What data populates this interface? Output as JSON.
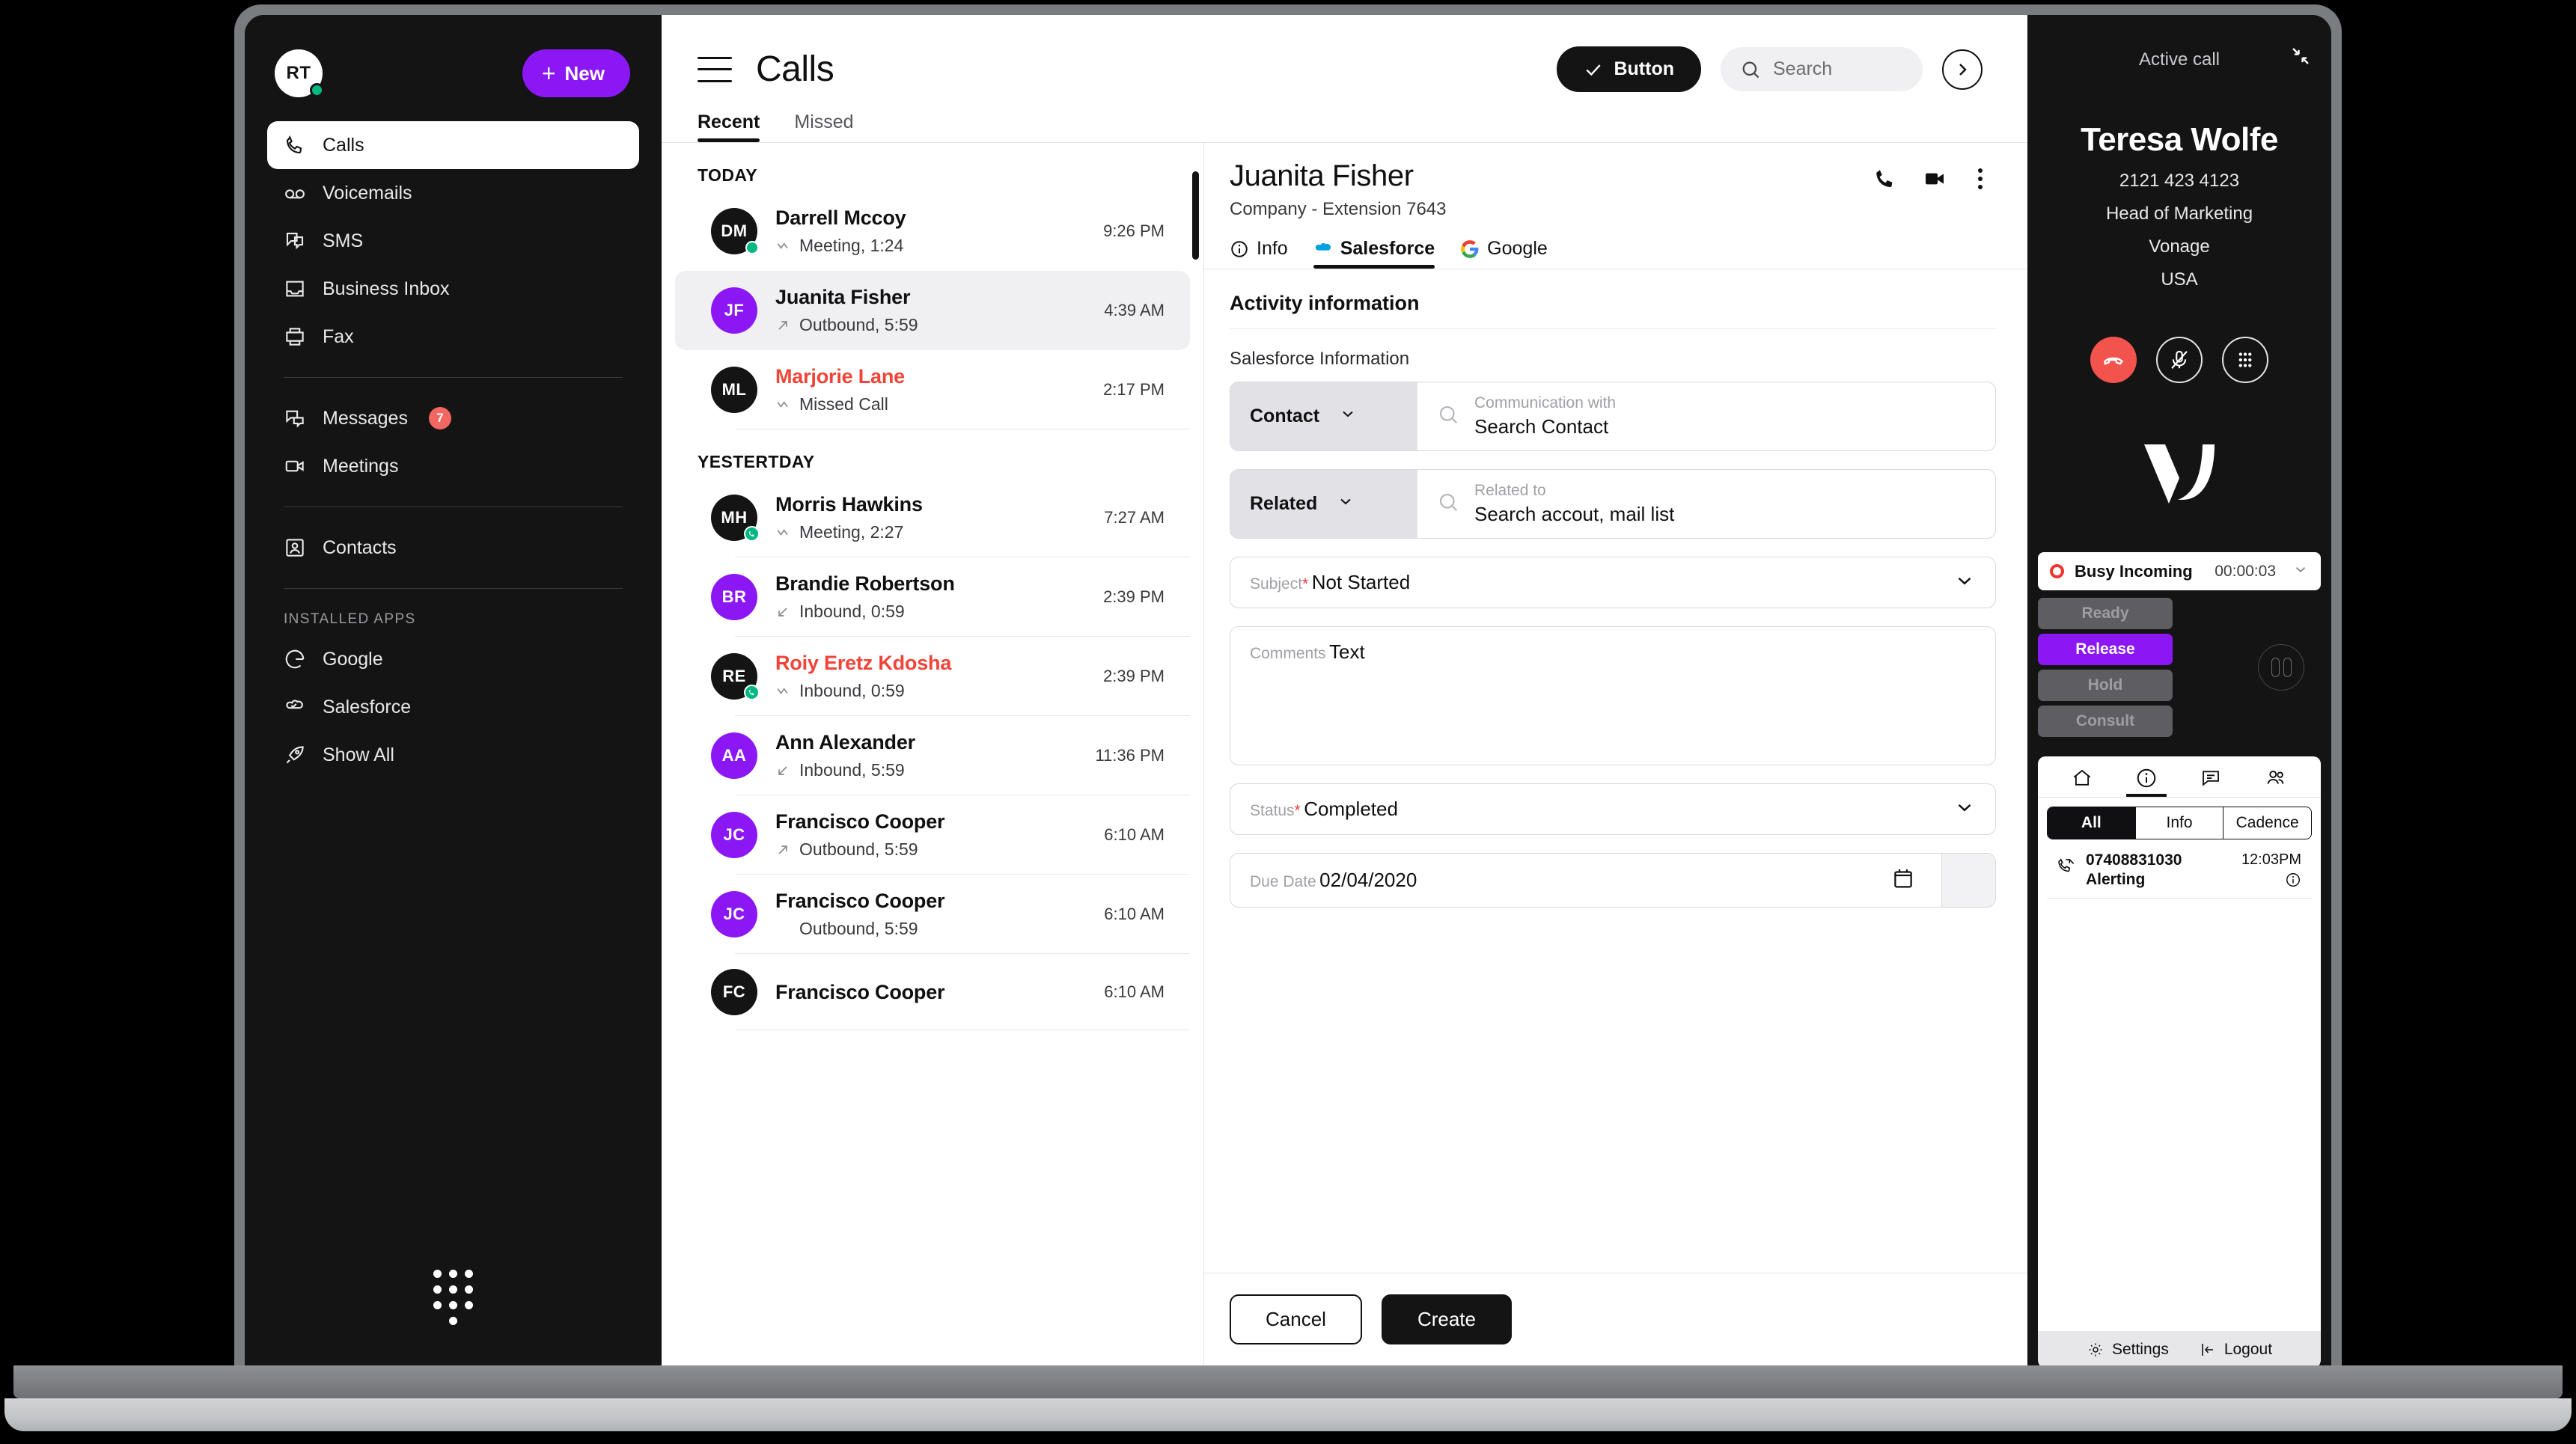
{
  "sidebar": {
    "avatar_initials": "RT",
    "new_button": "New",
    "items": [
      {
        "label": "Calls",
        "icon": "phone-icon"
      },
      {
        "label": "Voicemails",
        "icon": "voicemail-icon"
      },
      {
        "label": "SMS",
        "icon": "sms-icon"
      },
      {
        "label": "Business Inbox",
        "icon": "inbox-icon"
      },
      {
        "label": "Fax",
        "icon": "fax-icon"
      }
    ],
    "items2": [
      {
        "label": "Messages",
        "icon": "chat-icon",
        "badge": "7"
      },
      {
        "label": "Meetings",
        "icon": "video-icon"
      }
    ],
    "items3": [
      {
        "label": "Contacts",
        "icon": "contacts-icon"
      }
    ],
    "apps_label": "Installed apps",
    "apps": [
      {
        "label": "Google",
        "icon": "google-icon"
      },
      {
        "label": "Salesforce",
        "icon": "salesforce-cloud-icon"
      },
      {
        "label": "Show All",
        "icon": "rocket-icon"
      }
    ]
  },
  "header": {
    "title": "Calls",
    "button_label": "Button",
    "search_placeholder": "Search",
    "tabs": [
      {
        "label": "Recent",
        "active": true
      },
      {
        "label": "Missed",
        "active": false
      }
    ]
  },
  "call_list": {
    "groups": [
      {
        "label": "TODAY",
        "calls": [
          {
            "initials": "DM",
            "name": "Darrell Mccoy",
            "time": "9:26 PM",
            "detail": "Meeting, 1:24",
            "direction": "missed-arrow",
            "avatar": "dark",
            "presence": "online",
            "missed": false,
            "selected": false
          },
          {
            "initials": "JF",
            "name": "Juanita Fisher",
            "time": "4:39 AM",
            "detail": "Outbound, 5:59",
            "direction": "outbound",
            "avatar": "purple",
            "presence": "none",
            "missed": false,
            "selected": true
          },
          {
            "initials": "ML",
            "name": "Marjorie Lane",
            "time": "2:17 PM",
            "detail": "Missed Call",
            "direction": "missed-arrow",
            "avatar": "dark",
            "presence": "none",
            "missed": true,
            "selected": false
          }
        ]
      },
      {
        "label": "YESTERTDAY",
        "calls": [
          {
            "initials": "MH",
            "name": "Morris Hawkins",
            "time": "7:27 AM",
            "detail": "Meeting, 2:27",
            "direction": "missed-arrow",
            "avatar": "dark",
            "presence": "call",
            "missed": false,
            "selected": false
          },
          {
            "initials": "BR",
            "name": "Brandie Robertson",
            "time": "2:39 PM",
            "detail": "Inbound, 0:59",
            "direction": "inbound",
            "avatar": "purple",
            "presence": "none",
            "missed": false,
            "selected": false
          },
          {
            "initials": "RE",
            "name": "Roiy Eretz Kdosha",
            "time": "2:39 PM",
            "detail": "Inbound, 0:59",
            "direction": "missed-arrow",
            "avatar": "dark",
            "presence": "call",
            "missed": true,
            "selected": false
          },
          {
            "initials": "AA",
            "name": "Ann Alexander",
            "time": "11:36 PM",
            "detail": "Inbound, 5:59",
            "direction": "inbound",
            "avatar": "purple",
            "presence": "none",
            "missed": false,
            "selected": false
          },
          {
            "initials": "JC",
            "name": "Francisco Cooper",
            "time": "6:10 AM",
            "detail": "Outbound, 5:59",
            "direction": "outbound",
            "avatar": "purple",
            "presence": "none",
            "missed": false,
            "selected": false
          },
          {
            "initials": "JC",
            "name": "Francisco Cooper",
            "time": "6:10 AM",
            "detail": "Outbound, 5:59",
            "direction": "none",
            "avatar": "purple",
            "presence": "none",
            "missed": false,
            "selected": false
          },
          {
            "initials": "FC",
            "name": "Francisco Cooper",
            "time": "6:10 AM",
            "detail": "",
            "direction": "none",
            "avatar": "dark",
            "presence": "none",
            "missed": false,
            "selected": false
          }
        ]
      }
    ]
  },
  "detail": {
    "contact_name": "Juanita Fisher",
    "contact_meta": "Company -  Extension 7643",
    "tabs": [
      {
        "label": "Info",
        "icon": "info-icon",
        "active": false
      },
      {
        "label": "Salesforce",
        "icon": "salesforce-icon",
        "active": true
      },
      {
        "label": "Google",
        "icon": "google-icon",
        "active": false
      }
    ],
    "section_title": "Activity information",
    "subsection_title": "Salesforce Information",
    "fields": {
      "contact": {
        "picker_value": "Contact",
        "label": "Communication with",
        "value": "Search Contact"
      },
      "related": {
        "picker_value": "Related",
        "label": "Related to",
        "value": "Search accout, mail list"
      },
      "subject": {
        "label": "Subject",
        "required": "*",
        "value": "Not Started"
      },
      "comments": {
        "label": "Comments",
        "value": "Text"
      },
      "status": {
        "label": "Status",
        "required": "*",
        "value": "Completed"
      },
      "due_date": {
        "label": "Due Date",
        "value": "02/04/2020"
      }
    },
    "cancel_label": "Cancel",
    "create_label": "Create"
  },
  "cti": {
    "header_label": "Active call",
    "contact_name": "Teresa Wolfe",
    "phone": "2121 423 4123",
    "title": "Head of Marketing",
    "company": "Vonage",
    "country": "USA",
    "status": {
      "label": "Busy Incoming",
      "timer": "00:00:03"
    },
    "state_buttons": [
      {
        "label": "Ready",
        "active": false
      },
      {
        "label": "Release",
        "active": true
      },
      {
        "label": "Hold",
        "active": false
      },
      {
        "label": "Consult",
        "active": false
      }
    ],
    "segments": [
      {
        "label": "All",
        "active": true
      },
      {
        "label": "Info",
        "active": false
      },
      {
        "label": "Cadence",
        "active": false
      }
    ],
    "call_entry": {
      "number": "07408831030",
      "state": "Alerting",
      "time": "12:03PM"
    },
    "footer": [
      {
        "label": "Settings",
        "icon": "gear-icon"
      },
      {
        "label": "Logout",
        "icon": "logout-icon"
      }
    ]
  },
  "colors": {
    "accent_purple": "#8b18f4",
    "danger_red": "#f2534d",
    "missed_red": "#f04438",
    "online_green": "#00b884",
    "dark": "#141415"
  }
}
